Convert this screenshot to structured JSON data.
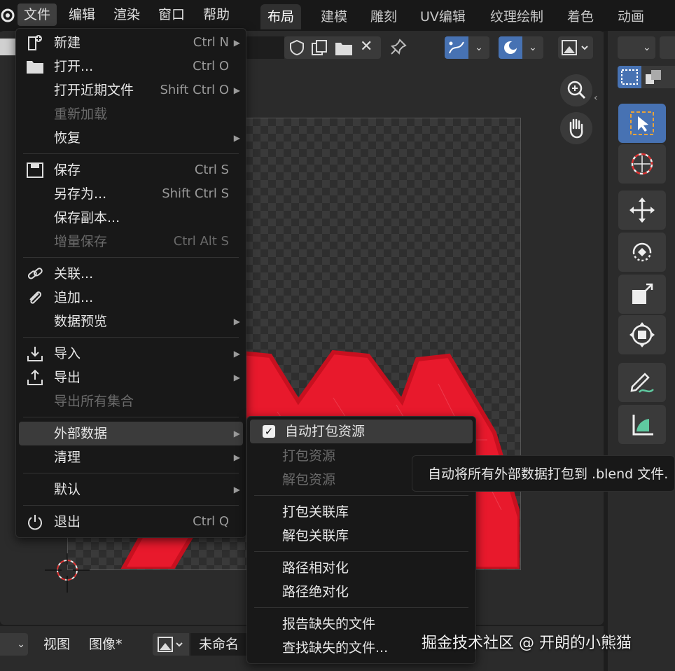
{
  "menubar": {
    "items": [
      "文件",
      "编辑",
      "渲染",
      "窗口",
      "帮助"
    ]
  },
  "workspaces": [
    "布局",
    "建模",
    "雕刻",
    "UV编辑",
    "纹理绘制",
    "着色",
    "动画"
  ],
  "file_menu": {
    "items": [
      {
        "label": "新建",
        "shortcut": "Ctrl N",
        "icon": "new-file-icon",
        "submenu": true
      },
      {
        "label": "打开...",
        "shortcut": "Ctrl O",
        "icon": "folder-icon"
      },
      {
        "label": "打开近期文件",
        "shortcut": "Shift Ctrl O",
        "submenu": true
      },
      {
        "label": "重新加载",
        "disabled": true
      },
      {
        "label": "恢复",
        "submenu": true
      },
      {
        "label": "保存",
        "shortcut": "Ctrl S",
        "icon": "save-icon"
      },
      {
        "label": "另存为...",
        "shortcut": "Shift Ctrl S"
      },
      {
        "label": "保存副本..."
      },
      {
        "label": "增量保存",
        "shortcut": "Ctrl Alt S",
        "disabled": true
      },
      {
        "label": "关联...",
        "icon": "link-icon"
      },
      {
        "label": "追加...",
        "icon": "paperclip-icon"
      },
      {
        "label": "数据预览",
        "submenu": true
      },
      {
        "label": "导入",
        "icon": "import-icon",
        "submenu": true
      },
      {
        "label": "导出",
        "icon": "export-icon",
        "submenu": true
      },
      {
        "label": "导出所有集合",
        "disabled": true
      },
      {
        "label": "外部数据",
        "submenu": true,
        "highlighted": true
      },
      {
        "label": "清理",
        "submenu": true
      },
      {
        "label": "默认",
        "submenu": true
      },
      {
        "label": "退出",
        "shortcut": "Ctrl Q",
        "icon": "power-icon"
      }
    ]
  },
  "external_data_menu": {
    "items": [
      {
        "label": "自动打包资源",
        "checked": true,
        "highlighted": true
      },
      {
        "label": "打包资源",
        "disabled": true
      },
      {
        "label": "解包资源",
        "disabled": true
      },
      {
        "label": "打包关联库"
      },
      {
        "label": "解包关联库"
      },
      {
        "label": "路径相对化"
      },
      {
        "label": "路径绝对化"
      },
      {
        "label": "报告缺失的文件"
      },
      {
        "label": "查找缺失的文件..."
      }
    ]
  },
  "tooltip": "自动将所有外部数据打包到 .blend 文件.",
  "bottom_bar": {
    "view": "视图",
    "image": "图像*",
    "name": "未命名"
  },
  "watermark": "掘金技术社区 @ 开朗的小熊猫",
  "colors": {
    "accent": "#4772b3",
    "texture_red": "#e8192c",
    "menu_bg": "#181818"
  }
}
